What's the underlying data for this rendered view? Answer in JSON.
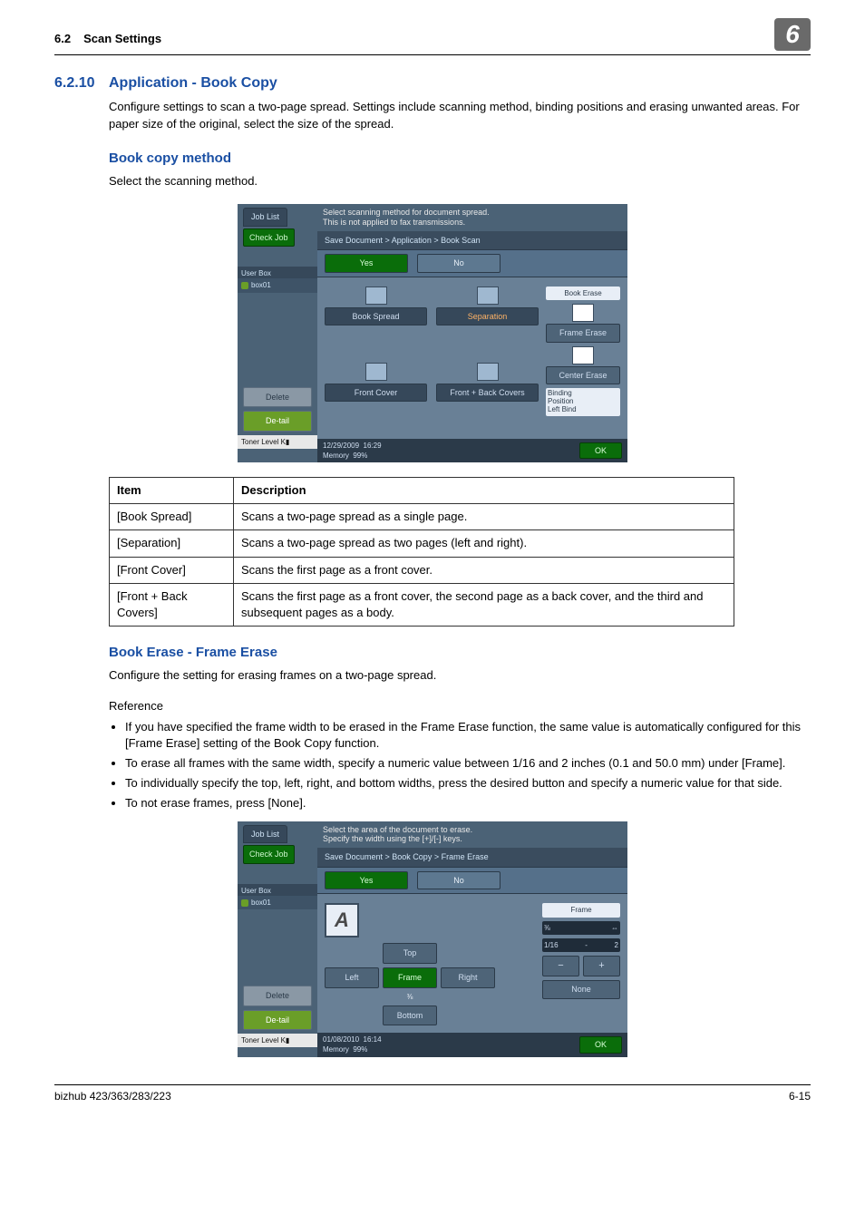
{
  "header": {
    "sec_num": "6.2",
    "sec_title": "Scan Settings",
    "badge": "6"
  },
  "section": {
    "num": "6.2.10",
    "title": "Application - Book Copy",
    "intro": "Configure settings to scan a two-page spread. Settings include scanning method, binding positions and erasing unwanted areas. For paper size of the original, select the size of the spread."
  },
  "sub1": {
    "title": "Book copy method",
    "body": "Select the scanning method."
  },
  "panel1": {
    "job_list": "Job List",
    "check_job": "Check Job",
    "inst1": "Select scanning method for document spread.",
    "inst2": "This is not applied to fax transmissions.",
    "breadcrumb": "Save Document > Application > Book Scan",
    "yes": "Yes",
    "no": "No",
    "user_box": "User Box",
    "box_item": "box01",
    "delete_btn": "Delete",
    "detail_btn": "De-tail",
    "toner": "Toner Level",
    "modes": {
      "book_spread": "Book Spread",
      "separation": "Separation",
      "front_cover": "Front Cover",
      "front_back": "Front + Back Covers"
    },
    "right": {
      "label": "Book Erase",
      "frame_erase": "Frame Erase",
      "center_erase": "Center Erase",
      "binding1": "Binding",
      "binding2": "Position",
      "binding3": "Left Bind"
    },
    "status_date": "12/29/2009",
    "status_time": "16:29",
    "status_mem": "Memory",
    "status_mem_pct": "99%",
    "ok": "OK"
  },
  "table": {
    "headers": {
      "item": "Item",
      "desc": "Description"
    },
    "rows": [
      {
        "item": "[Book Spread]",
        "desc": "Scans a two-page spread as a single page."
      },
      {
        "item": "[Separation]",
        "desc": "Scans a two-page spread as two pages (left and right)."
      },
      {
        "item": "[Front Cover]",
        "desc": "Scans the first page as a front cover."
      },
      {
        "item": "[Front + Back Covers]",
        "desc": "Scans the first page as a front cover, the second page as a back cover, and the third and subsequent pages as a body."
      }
    ]
  },
  "sub2": {
    "title": "Book Erase - Frame Erase",
    "body": "Configure the setting for erasing frames on a two-page spread.",
    "ref": "Reference",
    "bullets": [
      "If you have specified the frame width to be erased in the Frame Erase function, the same value is automatically configured for this [Frame Erase] setting of the Book Copy function.",
      "To erase all frames with the same width, specify a numeric value between 1/16 and 2 inches (0.1 and 50.0 mm) under [Frame].",
      "To individually specify the top, left, right, and bottom widths, press the desired button and specify a numeric value for that side.",
      "To not erase frames, press [None]."
    ]
  },
  "panel2": {
    "inst1": "Select the area of the document to erase.",
    "inst2": "Specify the width using the [+]/[-] keys.",
    "breadcrumb": "Save Document > Book Copy > Frame Erase",
    "a_icon": "A",
    "dir": {
      "top": "Top",
      "left": "Left",
      "frame": "Frame",
      "right": "Right",
      "bottom": "Bottom",
      "val": "⅜"
    },
    "right": {
      "label": "Frame",
      "val_l": "⅜",
      "val_r": "1/16",
      "val_dash": "-",
      "val_2": "2",
      "minus": "−",
      "plus": "+",
      "none": "None"
    },
    "status_date": "01/08/2010",
    "status_time": "16:14",
    "status_mem": "Memory",
    "status_mem_pct": "99%",
    "ok": "OK"
  },
  "footer": {
    "left": "bizhub 423/363/283/223",
    "right": "6-15"
  }
}
